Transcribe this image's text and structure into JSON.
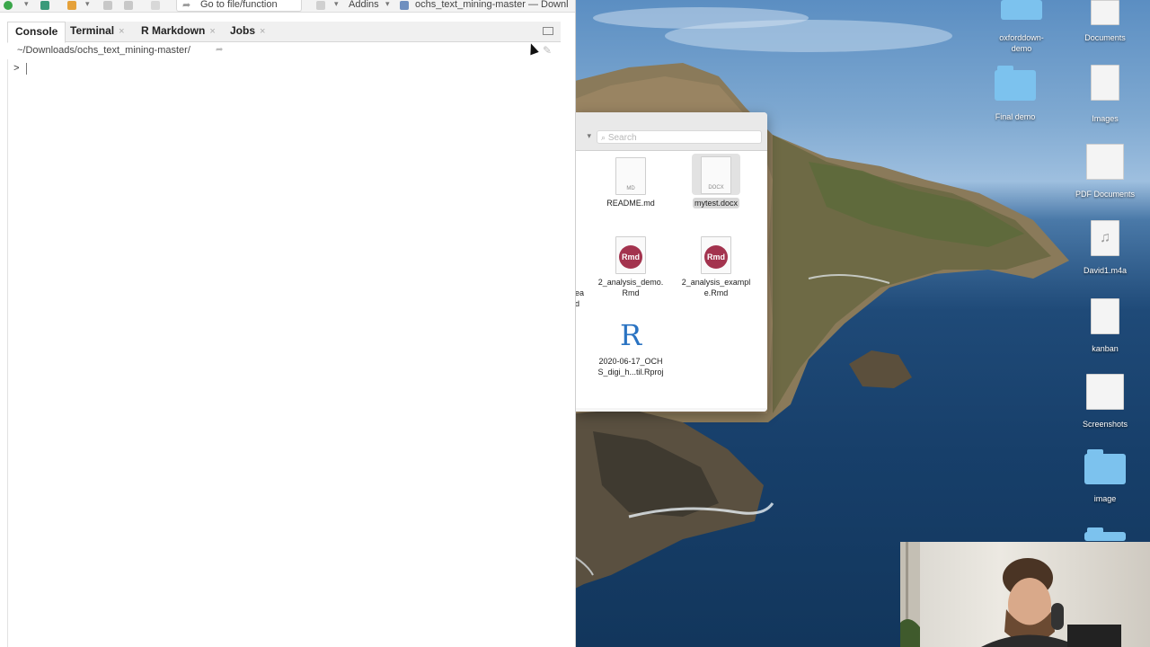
{
  "toolbar": {
    "goto_placeholder": "Go to file/function",
    "addins_label": "Addins",
    "project_title": "ochs_text_mining-master — Downl"
  },
  "console_pane": {
    "tabs": [
      {
        "label": "Console",
        "closable": false
      },
      {
        "label": "Terminal",
        "closable": true
      },
      {
        "label": "R Markdown",
        "closable": true
      },
      {
        "label": "Jobs",
        "closable": true
      }
    ],
    "close_glyph": "×",
    "path": "~/Downloads/ochs_text_mining-master/",
    "prompt": ">"
  },
  "finder": {
    "search_placeholder": "Search",
    "partial_label_lines": [
      "ea",
      "d"
    ],
    "items": [
      {
        "name": "README.md",
        "kind": "md",
        "tag": "MD"
      },
      {
        "name": "mytest.docx",
        "kind": "docx",
        "tag": "DOCX",
        "selected": true
      },
      {
        "name": "2_analysis_demo.Rmd",
        "kind": "rmd",
        "tag": "Rmd",
        "lines": [
          "2_analysis_demo.",
          "Rmd"
        ]
      },
      {
        "name": "2_analysis_example.Rmd",
        "kind": "rmd",
        "tag": "Rmd",
        "lines": [
          "2_analysis_exampl",
          "e.Rmd"
        ]
      },
      {
        "name": "2020-06-17_OCHS_digi_h...til.Rproj",
        "kind": "rproj",
        "tag": "R",
        "lines": [
          "2020-06-17_OCH",
          "S_digi_h...til.Rproj"
        ]
      }
    ]
  },
  "desktop": {
    "icons": [
      {
        "name": "oxforddown-demo",
        "kind": "folder",
        "lines": [
          "oxforddown-",
          "demo"
        ]
      },
      {
        "name": "Documents",
        "kind": "file"
      },
      {
        "name": "Final demo",
        "kind": "folder"
      },
      {
        "name": "Images",
        "kind": "file"
      },
      {
        "name": "PDF Documents",
        "kind": "pdf-stack"
      },
      {
        "name": "David1.m4a",
        "kind": "audio"
      },
      {
        "name": "kanban",
        "kind": "file"
      },
      {
        "name": "Screenshots",
        "kind": "file"
      },
      {
        "name": "image",
        "kind": "folder"
      }
    ]
  }
}
